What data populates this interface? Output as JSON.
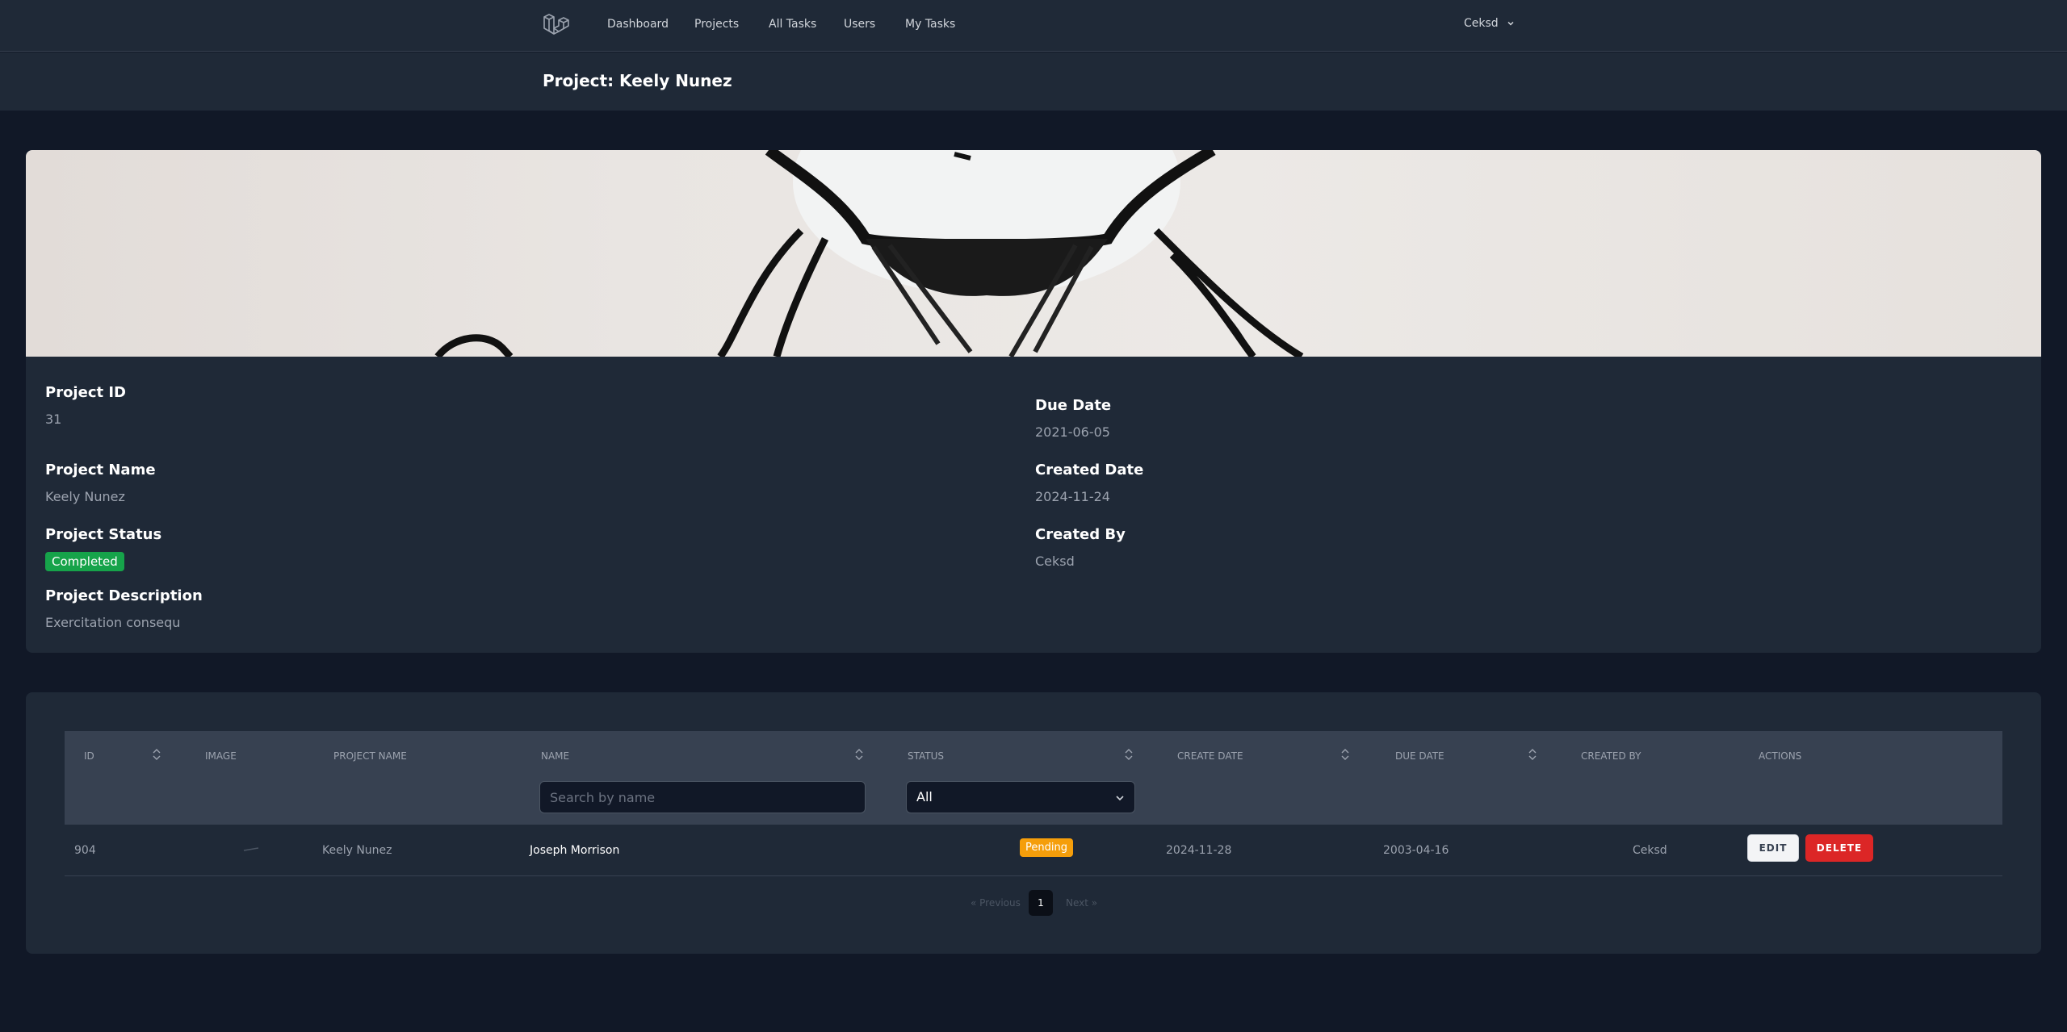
{
  "nav": {
    "links": [
      "Dashboard",
      "Projects",
      "All Tasks",
      "Users",
      "My Tasks"
    ],
    "user": "Ceksd"
  },
  "header": {
    "title": "Project: Keely Nunez"
  },
  "project": {
    "id_label": "Project ID",
    "id": "31",
    "name_label": "Project Name",
    "name": "Keely Nunez",
    "status_label": "Project Status",
    "status": "Completed",
    "description_label": "Project Description",
    "description": "Exercitation consequ",
    "due_label": "Due Date",
    "due": "2021-06-05",
    "created_label": "Created Date",
    "created": "2024-11-24",
    "created_by_label": "Created By",
    "created_by": "Ceksd"
  },
  "tasks": {
    "columns": [
      "ID",
      "Image",
      "Project Name",
      "Name",
      "Status",
      "Create Date",
      "Due Date",
      "Created By",
      "Actions"
    ],
    "search_placeholder": "Search by name",
    "status_filter": "All",
    "rows": [
      {
        "id": "904",
        "project_name": "Keely Nunez",
        "name": "Joseph Morrison",
        "status": "Pending",
        "create_date": "2024-11-28",
        "due_date": "2003-04-16",
        "created_by": "Ceksd",
        "edit_label": "EDIT",
        "delete_label": "DELETE"
      }
    ],
    "pagination": {
      "prev": "« Previous",
      "current": "1",
      "next": "Next »"
    }
  },
  "colors": {
    "background": "#111827",
    "surface": "#1f2937",
    "completed": "#16a34a",
    "pending": "#f59e0b",
    "delete": "#dc2626"
  }
}
